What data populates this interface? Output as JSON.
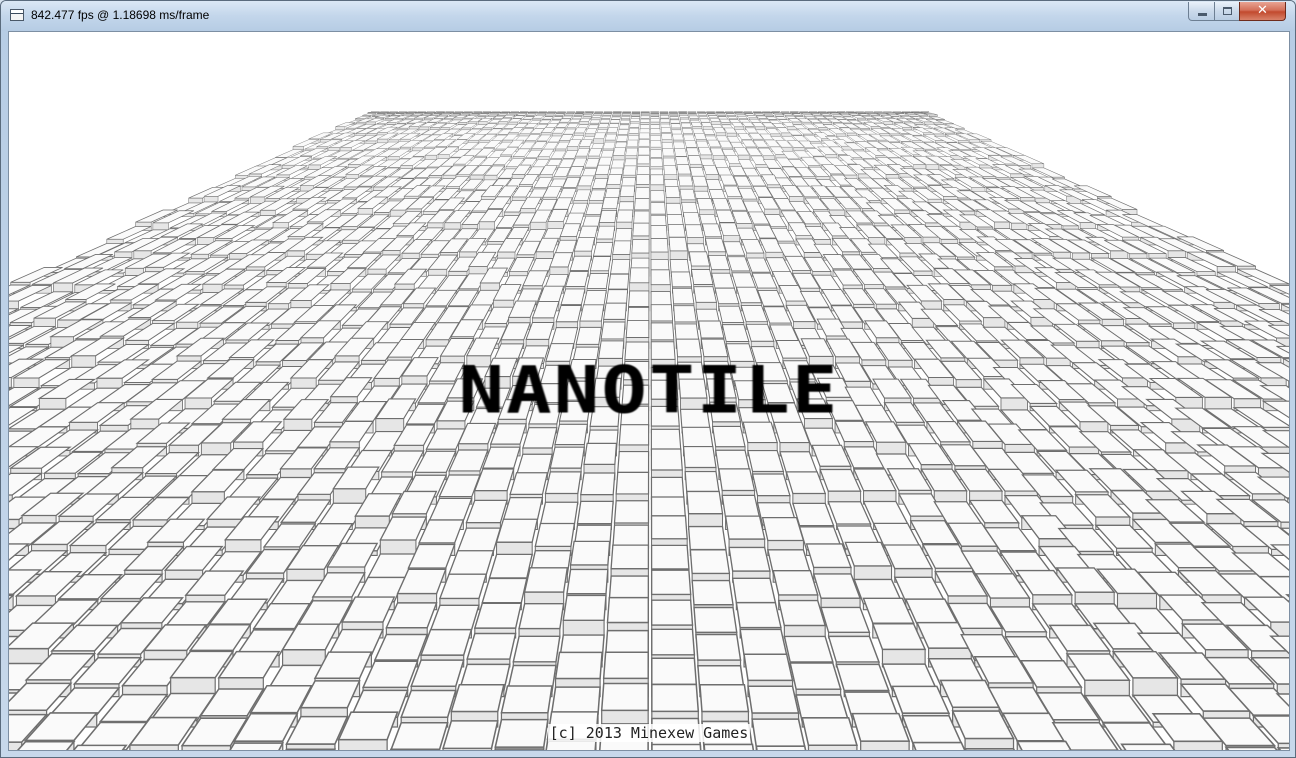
{
  "window": {
    "title": "842.477 fps @ 1.18698 ms/frame",
    "close_glyph": "✕"
  },
  "game": {
    "logo": "NANOTILE",
    "copyright": "[c] 2013 Minexew Games"
  },
  "colors": {
    "tile_top": "#fafafa",
    "tile_side": "#e6e6e6",
    "tile_edge": "#6e6e6e",
    "background": "#ffffff",
    "logo": "#000000"
  }
}
